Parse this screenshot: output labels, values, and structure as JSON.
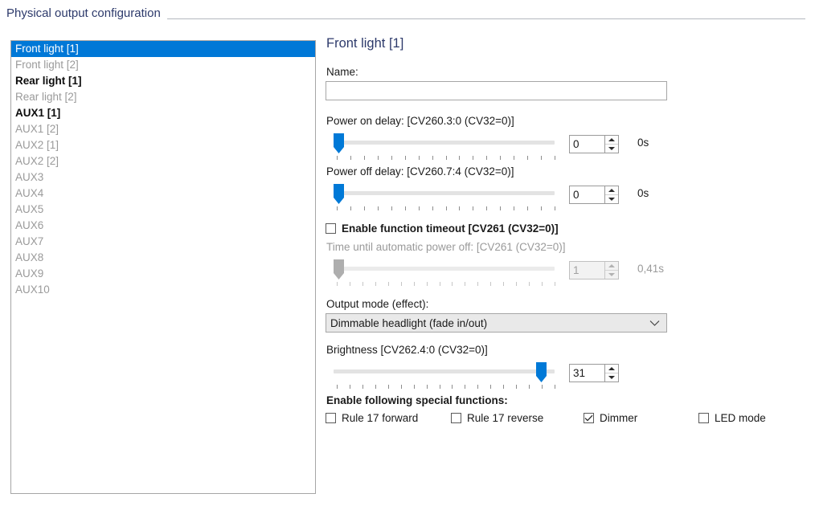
{
  "group": {
    "title": "Physical output configuration"
  },
  "outputs_list": [
    {
      "label": "Front light [1]",
      "state": "selected"
    },
    {
      "label": "Front light [2]",
      "state": "plain"
    },
    {
      "label": "Rear light [1]",
      "state": "bold"
    },
    {
      "label": "Rear light [2]",
      "state": "plain"
    },
    {
      "label": "AUX1 [1]",
      "state": "bold"
    },
    {
      "label": "AUX1 [2]",
      "state": "plain"
    },
    {
      "label": "AUX2 [1]",
      "state": "plain"
    },
    {
      "label": "AUX2 [2]",
      "state": "plain"
    },
    {
      "label": "AUX3",
      "state": "plain"
    },
    {
      "label": "AUX4",
      "state": "plain"
    },
    {
      "label": "AUX5",
      "state": "plain"
    },
    {
      "label": "AUX6",
      "state": "plain"
    },
    {
      "label": "AUX7",
      "state": "plain"
    },
    {
      "label": "AUX8",
      "state": "plain"
    },
    {
      "label": "AUX9",
      "state": "plain"
    },
    {
      "label": "AUX10",
      "state": "plain"
    }
  ],
  "detail": {
    "title": "Front light [1]",
    "name_label": "Name:",
    "name_value": "",
    "name_placeholder": "",
    "power_on": {
      "label": "Power on delay: [CV260.3:0 (CV32=0)]",
      "value": "0",
      "unit": "0s",
      "percent": 0,
      "ticks": 17,
      "enabled": true
    },
    "power_off": {
      "label": "Power off delay: [CV260.7:4 (CV32=0)]",
      "value": "0",
      "unit": "0s",
      "percent": 0,
      "ticks": 17,
      "enabled": true
    },
    "function_timeout": {
      "checkbox_label": "Enable function timeout [CV261 (CV32=0)]",
      "checked": false
    },
    "auto_power_off": {
      "label": "Time until automatic power off: [CV261 (CV32=0)]",
      "value": "1",
      "unit": "0,41s",
      "percent": 0,
      "ticks": 18,
      "enabled": false
    },
    "output_mode": {
      "label": "Output mode (effect):",
      "selected": "Dimmable headlight (fade in/out)"
    },
    "brightness": {
      "label": "Brightness [CV262.4:0 (CV32=0)]",
      "value": "31",
      "unit": "",
      "percent": 96,
      "ticks": 18,
      "enabled": true
    },
    "special_functions": {
      "label": "Enable following special functions:",
      "items": [
        {
          "label": "Rule 17 forward",
          "checked": false
        },
        {
          "label": "Rule 17 reverse",
          "checked": false
        },
        {
          "label": "Dimmer",
          "checked": true
        },
        {
          "label": "LED mode",
          "checked": false
        }
      ]
    }
  },
  "colors": {
    "accent": "#0078d7",
    "title": "#2d3a6b",
    "disabled_text": "#9a9a9a",
    "slider_track": "#e3e3e3",
    "disabled_thumb": "#aeaeae"
  }
}
